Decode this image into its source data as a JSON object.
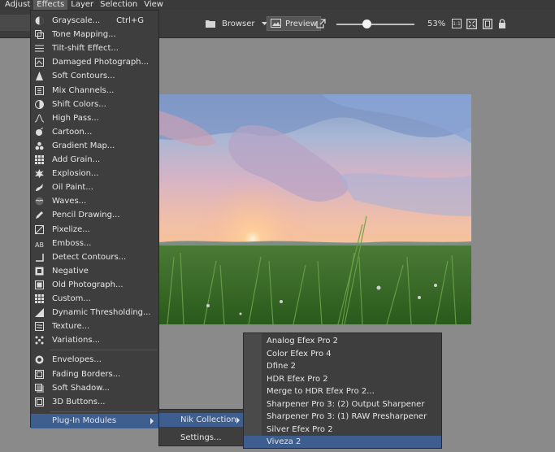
{
  "menubar": {
    "items": [
      "Adjust",
      "Effects",
      "Layer",
      "Selection",
      "View"
    ]
  },
  "toolbar": {
    "browser_label": "Browser",
    "preview_label": "Preview",
    "zoom_value": "53%",
    "one_to_one_label": "1:1"
  },
  "effects_menu": {
    "items": [
      {
        "label": "Grayscale...",
        "shortcut": "Ctrl+G",
        "icon": "grayscale-icon"
      },
      {
        "label": "Tone Mapping...",
        "icon": "tone-mapping-icon"
      },
      {
        "label": "Tilt-shift Effect...",
        "icon": "tilt-shift-icon"
      },
      {
        "label": "Damaged Photograph...",
        "icon": "damaged-photo-icon"
      },
      {
        "label": "Soft Contours...",
        "icon": "soft-contours-icon"
      },
      {
        "label": "Mix Channels...",
        "icon": "mix-channels-icon"
      },
      {
        "label": "Shift Colors...",
        "icon": "shift-colors-icon"
      },
      {
        "label": "High Pass...",
        "icon": "high-pass-icon"
      },
      {
        "label": "Cartoon...",
        "icon": "cartoon-icon"
      },
      {
        "label": "Gradient Map...",
        "icon": "gradient-map-icon"
      },
      {
        "label": "Add Grain...",
        "icon": "grain-icon"
      },
      {
        "label": "Explosion...",
        "icon": "explosion-icon"
      },
      {
        "label": "Oil Paint...",
        "icon": "oil-paint-icon"
      },
      {
        "label": "Waves...",
        "icon": "waves-icon"
      },
      {
        "label": "Pencil Drawing...",
        "icon": "pencil-icon"
      },
      {
        "label": "Pixelize...",
        "icon": "pixelize-icon"
      },
      {
        "label": "Emboss...",
        "icon": "emboss-icon"
      },
      {
        "label": "Detect Contours...",
        "icon": "contours-icon"
      },
      {
        "label": "Negative",
        "icon": "negative-icon"
      },
      {
        "label": "Old Photograph...",
        "icon": "old-photo-icon"
      },
      {
        "label": "Custom...",
        "icon": "custom-grid-icon"
      },
      {
        "label": "Dynamic Thresholding...",
        "icon": "threshold-icon"
      },
      {
        "label": "Texture...",
        "icon": "texture-icon"
      },
      {
        "label": "Variations...",
        "icon": "variations-icon"
      }
    ],
    "items2": [
      {
        "label": "Envelopes...",
        "icon": "envelopes-icon"
      },
      {
        "label": "Fading Borders...",
        "icon": "fading-borders-icon"
      },
      {
        "label": "Soft Shadow...",
        "icon": "soft-shadow-icon"
      },
      {
        "label": "3D Buttons...",
        "icon": "3d-buttons-icon"
      }
    ],
    "plugin_modules": "Plug-In Modules"
  },
  "nik_menu": {
    "items": [
      "Nik Collection",
      "Settings..."
    ]
  },
  "plugin_menu": {
    "items": [
      "Analog Efex Pro 2",
      "Color Efex Pro 4",
      "Dfine 2",
      "HDR Efex Pro 2",
      "Merge to HDR Efex Pro 2...",
      "Sharpener Pro 3: (2) Output Sharpener",
      "Sharpener Pro 3: (1) RAW Presharpener",
      "Silver Efex Pro 2",
      "Viveza 2"
    ],
    "selected": "Viveza 2"
  },
  "colors": {
    "menu_bg": "#3e3e3e",
    "highlight": "#3d5e8f",
    "workspace": "#8a8a8a"
  }
}
